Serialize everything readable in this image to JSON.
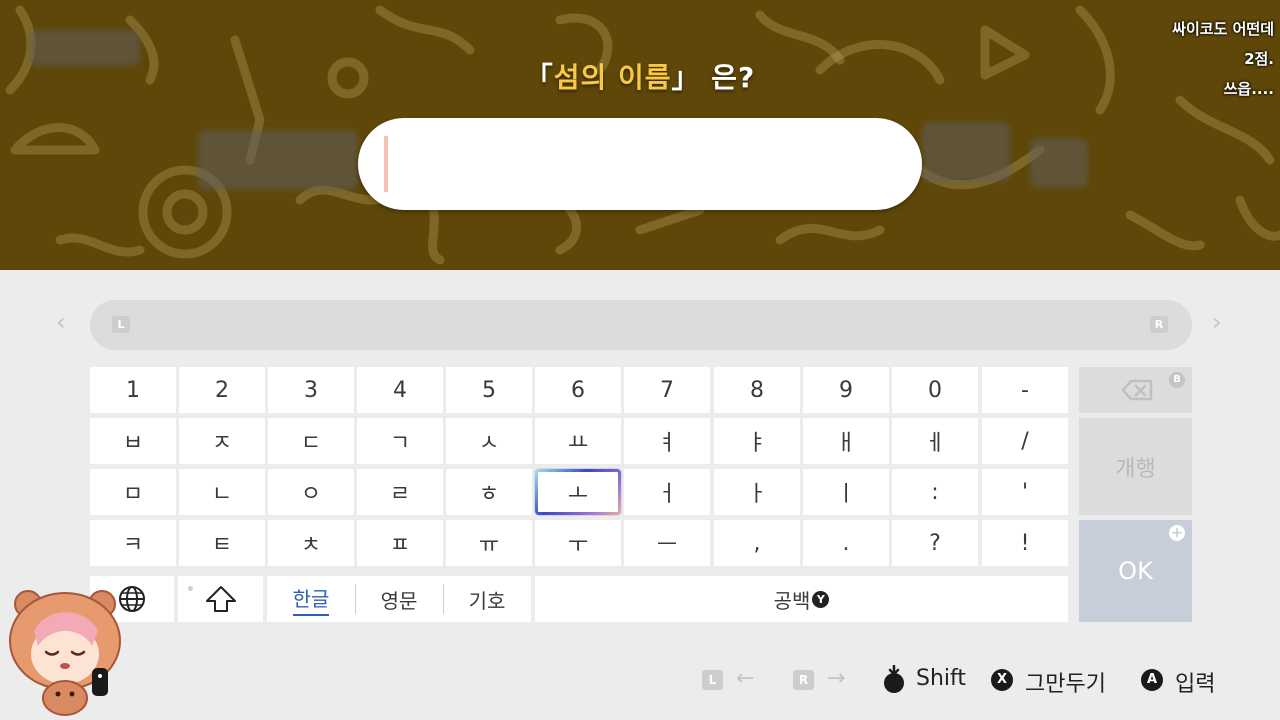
{
  "prompt": {
    "open_bracket": "「",
    "highlight": "섬의 이름",
    "close_bracket": "」",
    "suffix": " 은?"
  },
  "name_input": {
    "value": ""
  },
  "overlay": {
    "line1": "싸이코도 어떤데",
    "line2": "2점.",
    "line3": "쓰읍...."
  },
  "suggestion_bar": {
    "left_shoulder": "L",
    "right_shoulder": "R"
  },
  "keyboard": {
    "rows": [
      [
        "1",
        "2",
        "3",
        "4",
        "5",
        "6",
        "7",
        "8",
        "9",
        "0",
        "-"
      ],
      [
        "ㅂ",
        "ㅈ",
        "ㄷ",
        "ㄱ",
        "ㅅ",
        "ㅛ",
        "ㅕ",
        "ㅑ",
        "ㅐ",
        "ㅔ",
        "/"
      ],
      [
        "ㅁ",
        "ㄴ",
        "ㅇ",
        "ㄹ",
        "ㅎ",
        "ㅗ",
        "ㅓ",
        "ㅏ",
        "ㅣ",
        ":",
        "'"
      ],
      [
        "ㅋ",
        "ㅌ",
        "ㅊ",
        "ㅍ",
        "ㅠ",
        "ㅜ",
        "ㅡ",
        ",",
        ".",
        "?",
        "!"
      ]
    ],
    "selected_key": "ㅗ",
    "backspace_badge": "B",
    "enter_label": "개행",
    "ok_label": "OK",
    "ok_badge": "+",
    "modes": [
      "한글",
      "영문",
      "기호"
    ],
    "active_mode": "한글",
    "space_label": "공백",
    "space_badge": "Y"
  },
  "hints": {
    "l_button": "L",
    "r_button": "R",
    "left_arrow": "←",
    "right_arrow": "→",
    "shift_label": "Shift",
    "x_button": "X",
    "cancel_label": "그만두기",
    "a_button": "A",
    "confirm_label": "입력"
  },
  "colors": {
    "scene_bg": "#5f4709",
    "prompt_highlight": "#f7c947",
    "ok_bg": "#c8ced9",
    "active_mode": "#2e5fb8"
  }
}
